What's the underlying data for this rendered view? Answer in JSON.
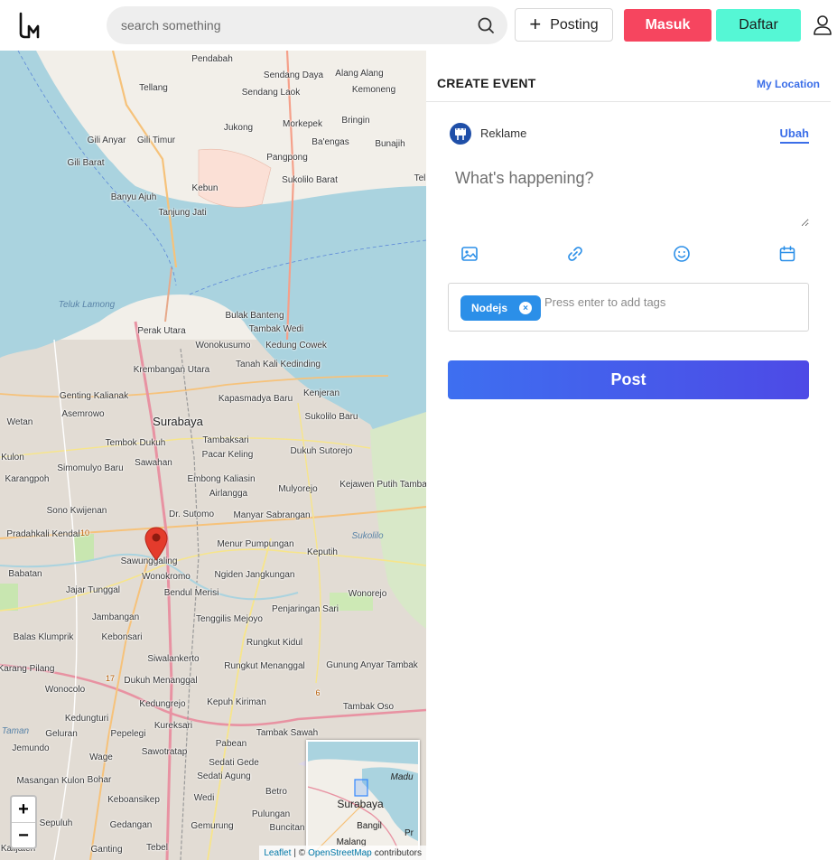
{
  "header": {
    "search_placeholder": "search something",
    "posting_label": "Posting",
    "masuk_label": "Masuk",
    "daftar_label": "Daftar"
  },
  "colors": {
    "masuk": "#f6455f",
    "daftar": "#55f7d5",
    "accent": "#3b6ee8",
    "tag": "#2b8fe8",
    "water": "#aad3df"
  },
  "map": {
    "places": [
      {
        "name": "Pendabah",
        "cls": ""
      },
      {
        "name": "Sendang Daya",
        "cls": ""
      },
      {
        "name": "Alang Alang",
        "cls": ""
      },
      {
        "name": "Tellang",
        "cls": ""
      },
      {
        "name": "Sendang Laok",
        "cls": ""
      },
      {
        "name": "Kemoneng",
        "cls": ""
      },
      {
        "name": "Morkepek",
        "cls": ""
      },
      {
        "name": "Bringin",
        "cls": ""
      },
      {
        "name": "Gili Anyar",
        "cls": ""
      },
      {
        "name": "Gili Timur",
        "cls": ""
      },
      {
        "name": "Jukong",
        "cls": ""
      },
      {
        "name": "Ba'engas",
        "cls": ""
      },
      {
        "name": "Bunajih",
        "cls": ""
      },
      {
        "name": "Gili Barat",
        "cls": ""
      },
      {
        "name": "Pangpong",
        "cls": ""
      },
      {
        "name": "Sukolilo Barat",
        "cls": ""
      },
      {
        "name": "Banyu Ajuh",
        "cls": ""
      },
      {
        "name": "Kebun",
        "cls": ""
      },
      {
        "name": "Tanjung Jati",
        "cls": ""
      },
      {
        "name": "Teluk Lamong",
        "cls": "water"
      },
      {
        "name": "Bulak Banteng",
        "cls": ""
      },
      {
        "name": "Perak Utara",
        "cls": ""
      },
      {
        "name": "Tambak Wedi",
        "cls": ""
      },
      {
        "name": "Wonokusumo",
        "cls": ""
      },
      {
        "name": "Kedung Cowek",
        "cls": ""
      },
      {
        "name": "Krembangan Utara",
        "cls": ""
      },
      {
        "name": "Tanah Kali Kedinding",
        "cls": ""
      },
      {
        "name": "Genting Kalianak",
        "cls": ""
      },
      {
        "name": "Kapasmadya Baru",
        "cls": ""
      },
      {
        "name": "Kenjeran",
        "cls": ""
      },
      {
        "name": "Asemrowo",
        "cls": ""
      },
      {
        "name": "Surabaya",
        "cls": "big"
      },
      {
        "name": "Sukolilo Baru",
        "cls": ""
      },
      {
        "name": "Wetan",
        "cls": ""
      },
      {
        "name": "Tembok Dukuh",
        "cls": ""
      },
      {
        "name": "Tambaksari",
        "cls": ""
      },
      {
        "name": "Dukuh Sutorejo",
        "cls": ""
      },
      {
        "name": "Kulon",
        "cls": ""
      },
      {
        "name": "Sawahan",
        "cls": ""
      },
      {
        "name": "Pacar Keling",
        "cls": ""
      },
      {
        "name": "Simomulyo Baru",
        "cls": ""
      },
      {
        "name": "Embong Kaliasin",
        "cls": ""
      },
      {
        "name": "Mulyorejo",
        "cls": ""
      },
      {
        "name": "Karangpoh",
        "cls": ""
      },
      {
        "name": "Airlangga",
        "cls": ""
      },
      {
        "name": "Kejawen Putih Tambak",
        "cls": ""
      },
      {
        "name": "Sono Kwijenan",
        "cls": ""
      },
      {
        "name": "Dr. Sutomo",
        "cls": ""
      },
      {
        "name": "Manyar Sabrangan",
        "cls": ""
      },
      {
        "name": "Pradahkali Kendal",
        "cls": ""
      },
      {
        "name": "Menur Pumpungan",
        "cls": ""
      },
      {
        "name": "Sukolilo",
        "cls": "water"
      },
      {
        "name": "Sawunggaling",
        "cls": ""
      },
      {
        "name": "Keputih",
        "cls": ""
      },
      {
        "name": "Babatan",
        "cls": ""
      },
      {
        "name": "Wonokromo",
        "cls": ""
      },
      {
        "name": "Ngiden Jangkungan",
        "cls": ""
      },
      {
        "name": "Jajar Tunggal",
        "cls": ""
      },
      {
        "name": "Bendul Merisi",
        "cls": ""
      },
      {
        "name": "Wonorejo",
        "cls": ""
      },
      {
        "name": "Jambangan",
        "cls": ""
      },
      {
        "name": "Tenggilis Mejoyo",
        "cls": ""
      },
      {
        "name": "Penjaringan Sari",
        "cls": ""
      },
      {
        "name": "Balas Klumprik",
        "cls": ""
      },
      {
        "name": "Kebonsari",
        "cls": ""
      },
      {
        "name": "Rungkut Kidul",
        "cls": ""
      },
      {
        "name": "Siwalankerto",
        "cls": ""
      },
      {
        "name": "Karang Pilang",
        "cls": ""
      },
      {
        "name": "Rungkut Menanggal",
        "cls": ""
      },
      {
        "name": "Gunung Anyar Tambak",
        "cls": ""
      },
      {
        "name": "Dukuh Menanggal",
        "cls": ""
      },
      {
        "name": "Wonocolo",
        "cls": ""
      },
      {
        "name": "Kedungrejo",
        "cls": ""
      },
      {
        "name": "Kepuh Kiriman",
        "cls": ""
      },
      {
        "name": "Tambak Oso",
        "cls": ""
      },
      {
        "name": "Kedungturi",
        "cls": ""
      },
      {
        "name": "Geluran",
        "cls": ""
      },
      {
        "name": "Pepelegi",
        "cls": ""
      },
      {
        "name": "Kureksari",
        "cls": ""
      },
      {
        "name": "Taman",
        "cls": "water"
      },
      {
        "name": "Tambak Sawah",
        "cls": ""
      },
      {
        "name": "Jemundo",
        "cls": ""
      },
      {
        "name": "Wage",
        "cls": ""
      },
      {
        "name": "Sawotratap",
        "cls": ""
      },
      {
        "name": "Pabean",
        "cls": ""
      },
      {
        "name": "Sedati Gede",
        "cls": ""
      },
      {
        "name": "Masangan Kulon",
        "cls": ""
      },
      {
        "name": "Bohar",
        "cls": ""
      },
      {
        "name": "Sedati Agung",
        "cls": ""
      },
      {
        "name": "Betro",
        "cls": ""
      },
      {
        "name": "Keboansikep",
        "cls": ""
      },
      {
        "name": "Wedi",
        "cls": ""
      },
      {
        "name": "Sepuluh",
        "cls": ""
      },
      {
        "name": "Gedangan",
        "cls": ""
      },
      {
        "name": "Gemurung",
        "cls": ""
      },
      {
        "name": "Pulungan",
        "cls": ""
      },
      {
        "name": "Buncitan",
        "cls": ""
      },
      {
        "name": "Tebel",
        "cls": ""
      },
      {
        "name": "Tel",
        "cls": ""
      },
      {
        "name": "Kalijaten",
        "cls": ""
      },
      {
        "name": "Ganting",
        "cls": ""
      },
      {
        "name": "10",
        "cls": "numl"
      },
      {
        "name": "17",
        "cls": "numl"
      },
      {
        "name": "6",
        "cls": "numl"
      }
    ],
    "zoom_in": "+",
    "zoom_out": "−",
    "minimap": {
      "labels": [
        "Madu",
        "Surabaya",
        "Bangil",
        "Malang",
        "Pr"
      ]
    },
    "attribution": {
      "leaflet": "Leaflet",
      "sep": "| ©",
      "osm": "OpenStreetMap",
      "contributors": "contributors"
    }
  },
  "panel": {
    "title": "CREATE EVENT",
    "my_location": "My Location",
    "category": "Reklame",
    "change": "Ubah",
    "text_placeholder": "What's happening?",
    "tools": [
      "image-icon",
      "link-icon",
      "emoji-icon",
      "calendar-icon"
    ],
    "tags": [
      "Nodejs"
    ],
    "tag_remove": "×",
    "tag_placeholder": "Press enter to add tags",
    "post_label": "Post"
  }
}
